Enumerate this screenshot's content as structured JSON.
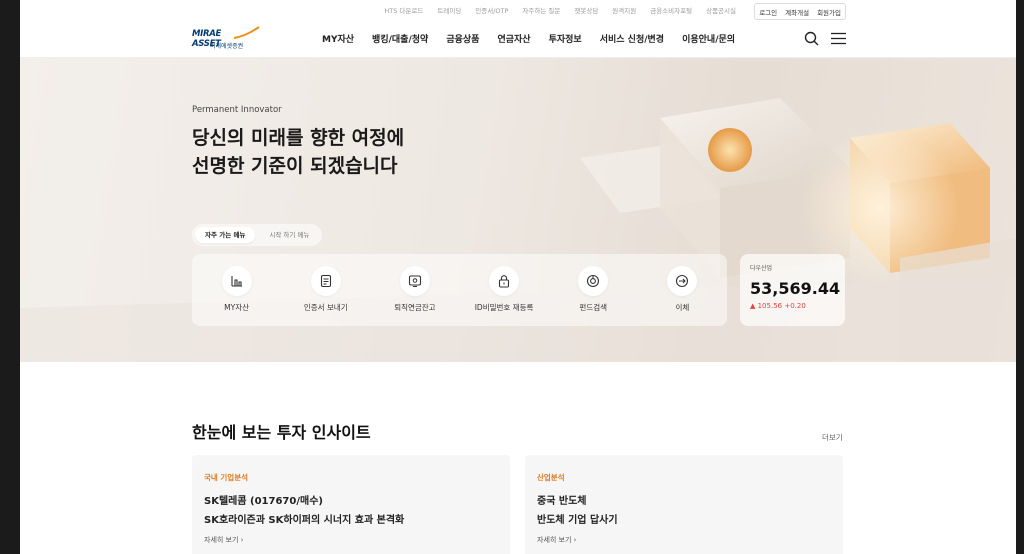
{
  "utility_links": [
    "HTS 다운로드",
    "트레이딩",
    "인증서/OTP",
    "자주하는 질문",
    "챗봇상담",
    "원격지원",
    "금융소비자포털",
    "상품공시실"
  ],
  "auth": {
    "login": "로그인",
    "open_account": "계좌개설",
    "signup": "회원가입"
  },
  "logo": {
    "main": "MIRAE ASSET",
    "sub": "미래에셋증권"
  },
  "gnb": [
    "MY자산",
    "뱅킹/대출/청약",
    "금융상품",
    "연금자산",
    "투자정보",
    "서비스 신청/변경",
    "이용안내/문의"
  ],
  "hero": {
    "eyebrow": "Permanent Innovator",
    "title_line1": "당신의 미래를 향한 여정에",
    "title_line2": "선명한 기준이 되겠습니다",
    "tabs": [
      "자주 가는 메뉴",
      "시작 하기 메뉴"
    ],
    "quick_menu": [
      {
        "label": "MY자산",
        "icon": "chart-bar-icon"
      },
      {
        "label": "인증서 보내기",
        "icon": "certificate-icon"
      },
      {
        "label": "퇴직연금잔고",
        "icon": "pension-icon"
      },
      {
        "label": "ID비밀번호 재등록",
        "icon": "lock-icon"
      },
      {
        "label": "펀드검색",
        "icon": "fund-search-icon"
      },
      {
        "label": "이체",
        "icon": "transfer-icon"
      }
    ]
  },
  "index": {
    "name": "다우산업",
    "value": "53,569.44",
    "change": "▲ 105.56 +0.20",
    "color": "#e0443a"
  },
  "insight": {
    "title": "한눈에 보는 투자 인사이트",
    "more": "더보기",
    "cards": [
      {
        "category": "국내 기업분석",
        "line1": "SK텔레콤 (017670/매수)",
        "line2": "SK호라이즌과 SK하이퍼의 시너지 효과 본격화",
        "link": "자세히 보기  ›"
      },
      {
        "category": "산업분석",
        "line1": "중국 반도체",
        "line2": "반도체 기업 답사기",
        "link": "자세히 보기  ›"
      }
    ]
  },
  "colors": {
    "brand": "#043b72",
    "accent": "#e07a1f",
    "up": "#e0443a"
  }
}
